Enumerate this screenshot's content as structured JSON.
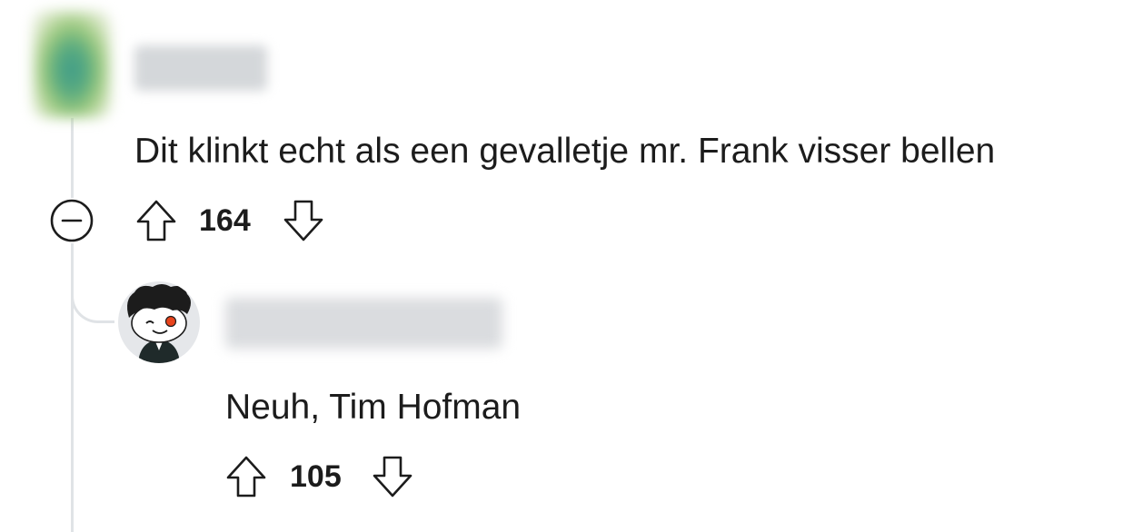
{
  "comments": [
    {
      "text": "Dit klinkt echt als een gevalletje mr. Frank visser bellen",
      "votes": "164",
      "icons": {
        "avatar": "avatar-icon",
        "collapse": "collapse-minus-icon",
        "upvote": "upvote-arrow-icon",
        "downvote": "downvote-arrow-icon"
      }
    },
    {
      "text": "Neuh, Tim Hofman",
      "votes": "105",
      "icons": {
        "avatar": "snoo-avatar-icon",
        "upvote": "upvote-arrow-icon",
        "downvote": "downvote-arrow-icon"
      }
    }
  ]
}
